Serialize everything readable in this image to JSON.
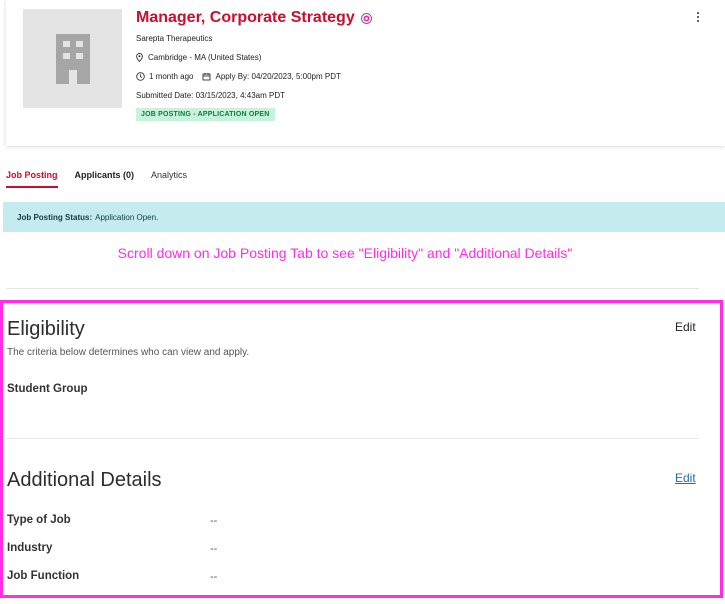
{
  "job": {
    "title": "Manager, Corporate Strategy",
    "company": "Sarepta Therapeutics",
    "location": "Cambridge - MA (United States)",
    "posted_ago": "1 month ago",
    "apply_by": "Apply By: 04/20/2023, 5:00pm PDT",
    "submitted": "Submitted Date: 03/15/2023, 4:43am PDT",
    "status_pill": "JOB POSTING - APPLICATION OPEN"
  },
  "tabs": [
    {
      "label": "Job Posting"
    },
    {
      "label": "Applicants (0)"
    },
    {
      "label": "Analytics"
    }
  ],
  "banner": {
    "label": "Job Posting Status:",
    "value": "Application Open."
  },
  "annotation": "Scroll down on Job Posting Tab to see \"Eligibility\" and \"Additional Details\"",
  "eligibility": {
    "title": "Eligibility",
    "subtitle": "The criteria below determines who can view and apply.",
    "edit_label": "Edit",
    "student_group_label": "Student Group"
  },
  "additional_details": {
    "title": "Additional Details",
    "edit_label": "Edit",
    "rows": [
      {
        "label": "Type of Job",
        "value": "--"
      },
      {
        "label": "Industry",
        "value": "--"
      },
      {
        "label": "Job Function",
        "value": "--"
      }
    ]
  },
  "colors": {
    "brand": "#c8102e",
    "annotation": "#ff2ee6",
    "status_banner_bg": "#c6ebef",
    "pill_bg": "#c7f2dc",
    "link": "#1d6fa5"
  },
  "icons": {
    "logo": "building-icon",
    "title_badge": "verified-badge-icon",
    "location": "location-pin-icon",
    "clock": "clock-icon",
    "calendar": "calendar-icon",
    "menu": "kebab-menu-icon"
  }
}
